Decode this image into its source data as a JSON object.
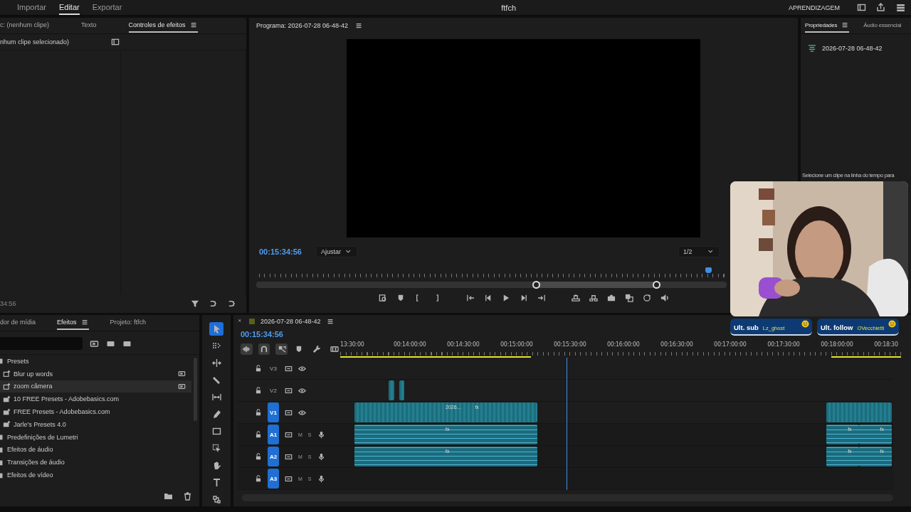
{
  "topbar": {
    "nav": [
      {
        "label": "Importar",
        "selected": false
      },
      {
        "label": "Editar",
        "selected": true
      },
      {
        "label": "Exportar",
        "selected": false
      }
    ],
    "title": "ftfch",
    "learn": "APRENDIZAGEM"
  },
  "effect_controls": {
    "tabs": [
      {
        "label": "c: (nenhum clipe)",
        "selected": false
      },
      {
        "label": "Texto",
        "selected": false
      },
      {
        "label": "Controles de efeitos",
        "selected": true
      }
    ],
    "subtitle": "nhum clipe selecionado)",
    "timecode": "34:56"
  },
  "program": {
    "title": "Programa: 2026-07-28 06-48-42",
    "timecode": "00:15:34:56",
    "fit": "Ajustar",
    "resolution": "1/2"
  },
  "properties": {
    "tabs": [
      {
        "label": "Propriedades",
        "selected": true
      },
      {
        "label": "Áudio essencial",
        "selected": false
      }
    ],
    "sequence": "2026-07-28 06-48-42",
    "hint": "Selecione um clipe na linha do tempo para"
  },
  "effects": {
    "tabs": [
      {
        "label": "dor de mídia",
        "selected": false
      },
      {
        "label": "Efeitos",
        "selected": true
      },
      {
        "label": "Projeto: ftfch",
        "selected": false
      }
    ],
    "tree": [
      {
        "label": "Presets",
        "kind": "folder",
        "selected": false,
        "children": [
          {
            "label": "Blur up words",
            "kind": "preset",
            "selected": false
          },
          {
            "label": "zoom câmera",
            "kind": "preset",
            "selected": true
          },
          {
            "label": "10 FREE Presets - Adobebasics.com",
            "kind": "bin",
            "selected": false
          },
          {
            "label": "FREE Presets - Adobebasics.com",
            "kind": "bin",
            "selected": false
          },
          {
            "label": "Jarle's Presets 4.0",
            "kind": "bin",
            "selected": false
          }
        ]
      },
      {
        "label": "Predefinições de Lumetri",
        "kind": "folder",
        "selected": false
      },
      {
        "label": "Efeitos de áudio",
        "kind": "folder",
        "selected": false
      },
      {
        "label": "Transições de áudio",
        "kind": "folder",
        "selected": false
      },
      {
        "label": "Efeitos de vídeo",
        "kind": "folder",
        "selected": false
      }
    ]
  },
  "timeline": {
    "sequence": "2026-07-28 06-48-42",
    "timecode": "00:15:34:56",
    "ruler": [
      "13:30:00",
      "00:14:00:00",
      "00:14:30:00",
      "00:15:00:00",
      "00:15:30:00",
      "00:16:00:00",
      "00:16:30:00",
      "00:17:00:00",
      "00:17:30:00",
      "00:18:00:00",
      "00:18:30"
    ],
    "tracks": [
      {
        "name": "V3",
        "kind": "video",
        "targeted": false
      },
      {
        "name": "V2",
        "kind": "video",
        "targeted": false,
        "clips": [
          {
            "kind": "video"
          },
          {
            "kind": "video"
          }
        ]
      },
      {
        "name": "V1",
        "kind": "video",
        "targeted": true,
        "clips": [
          {
            "kind": "video",
            "labels": [
              "2026...",
              "fx"
            ]
          },
          {
            "kind": "video"
          }
        ]
      },
      {
        "name": "A1",
        "kind": "audio",
        "targeted": true,
        "mute": "M",
        "solo": "S",
        "clips": [
          {
            "kind": "audio",
            "labels": [
              "fx"
            ]
          },
          {
            "kind": "audio",
            "labels": [
              "fx"
            ]
          },
          {
            "kind": "audio",
            "labels": [
              "fx"
            ]
          }
        ]
      },
      {
        "name": "A2",
        "kind": "audio",
        "targeted": true,
        "mute": "M",
        "solo": "S",
        "clips": [
          {
            "kind": "audio",
            "labels": [
              "fx"
            ]
          },
          {
            "kind": "audio",
            "labels": [
              "fx"
            ]
          },
          {
            "kind": "audio",
            "labels": [
              "fx"
            ]
          }
        ]
      },
      {
        "name": "A3",
        "kind": "audio",
        "targeted": true,
        "mute": "M",
        "solo": "S"
      }
    ]
  },
  "overlay": {
    "badges": [
      {
        "label": "Ult. sub",
        "user": "Lz_ghost"
      },
      {
        "label": "Ult. follow",
        "user": "OVecchietti"
      }
    ]
  }
}
